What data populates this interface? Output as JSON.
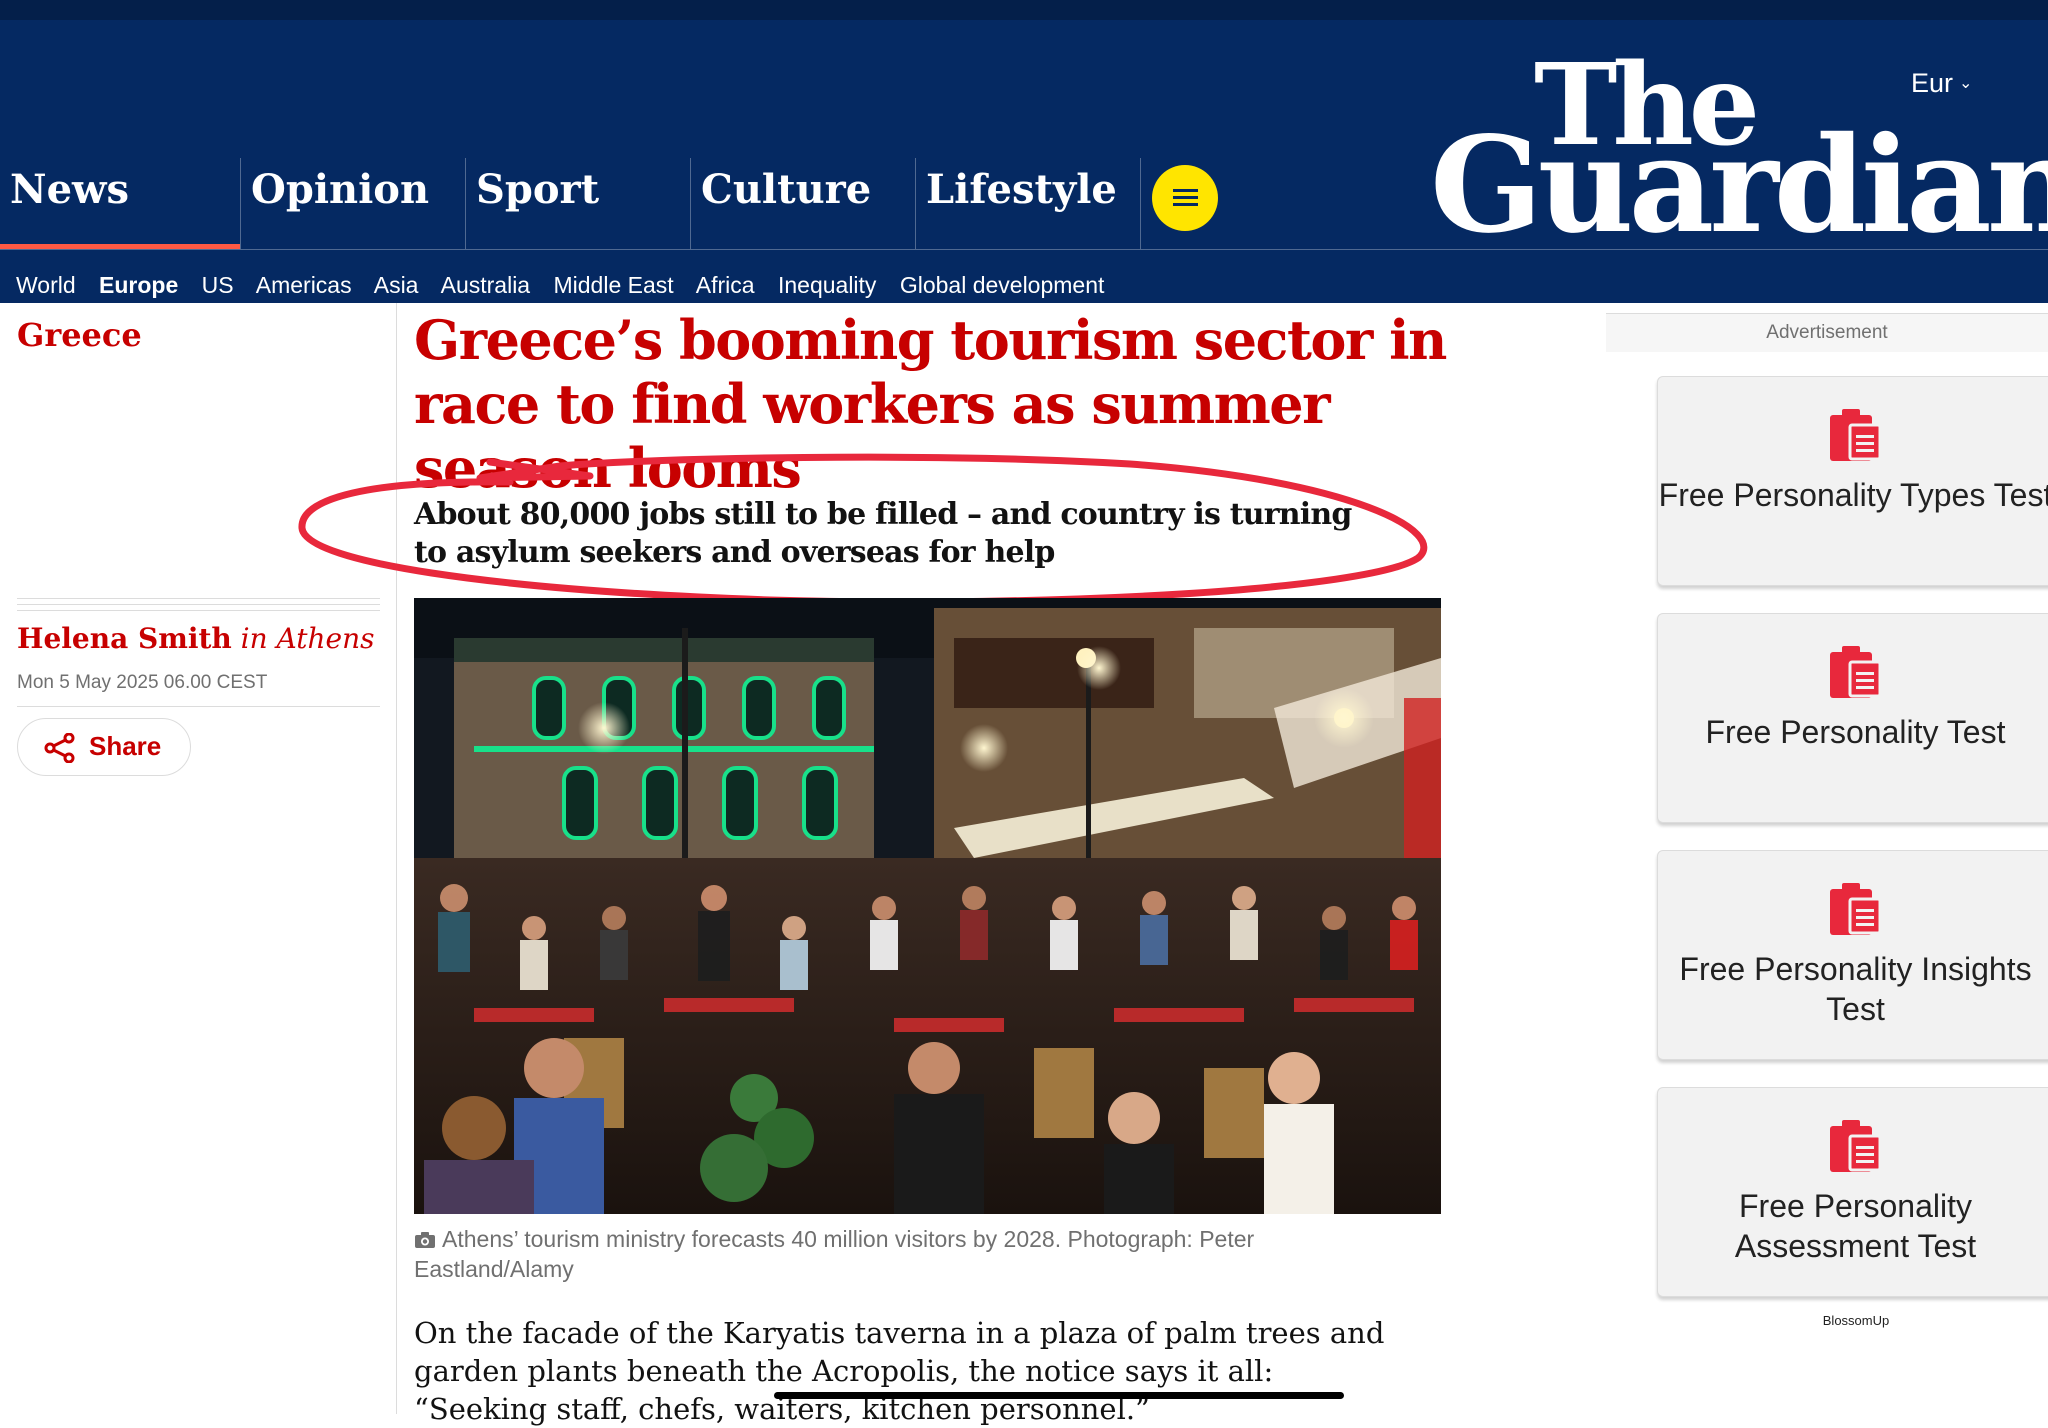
{
  "header": {
    "edition": "Eur",
    "logo": {
      "line1": "The",
      "line2": "Guardian"
    },
    "pillars": [
      {
        "label": "News",
        "active": true
      },
      {
        "label": "Opinion"
      },
      {
        "label": "Sport"
      },
      {
        "label": "Culture"
      },
      {
        "label": "Lifestyle"
      }
    ],
    "subnav": [
      {
        "label": "World"
      },
      {
        "label": "Europe",
        "active": true
      },
      {
        "label": "US"
      },
      {
        "label": "Americas"
      },
      {
        "label": "Asia"
      },
      {
        "label": "Australia"
      },
      {
        "label": "Middle East"
      },
      {
        "label": "Africa"
      },
      {
        "label": "Inequality"
      },
      {
        "label": "Global development"
      }
    ]
  },
  "article": {
    "section": "Greece",
    "headline": "Greece’s booming tourism sector in race to find workers as summer season looms",
    "standfirst": "About 80,000 jobs still to be filled – and country is turning to asylum seekers and overseas for help",
    "byline": {
      "name": "Helena Smith",
      "location": "in Athens"
    },
    "date": "Mon 5 May 2025 06.00 CEST",
    "share_label": "Share",
    "caption": "Athens’ tourism ministry forecasts 40 million visitors by 2028. Photograph: Peter Eastland/Alamy",
    "body": "On the facade of the Karyatis taverna in a plaza of palm trees and garden plants beneath the Acropolis, the notice says it all: “Seeking staff, chefs, waiters, kitchen personnel.”"
  },
  "sidebar": {
    "ad_label": "Advertisement",
    "ads": [
      {
        "label": "Free Personality Types Test"
      },
      {
        "label": "Free Personality Test"
      },
      {
        "label": "Free Personality Insights Test"
      },
      {
        "label": "Free Personality Assessment Test"
      }
    ],
    "ad_brand": "BlossomUp"
  },
  "colors": {
    "brand_navy": "#052962",
    "news_red": "#c70000",
    "menu_yellow": "#ffe500",
    "annotation_red": "#e8283c"
  },
  "icons": [
    "menu-icon",
    "share-icon",
    "camera-icon",
    "clipboard-icon"
  ]
}
